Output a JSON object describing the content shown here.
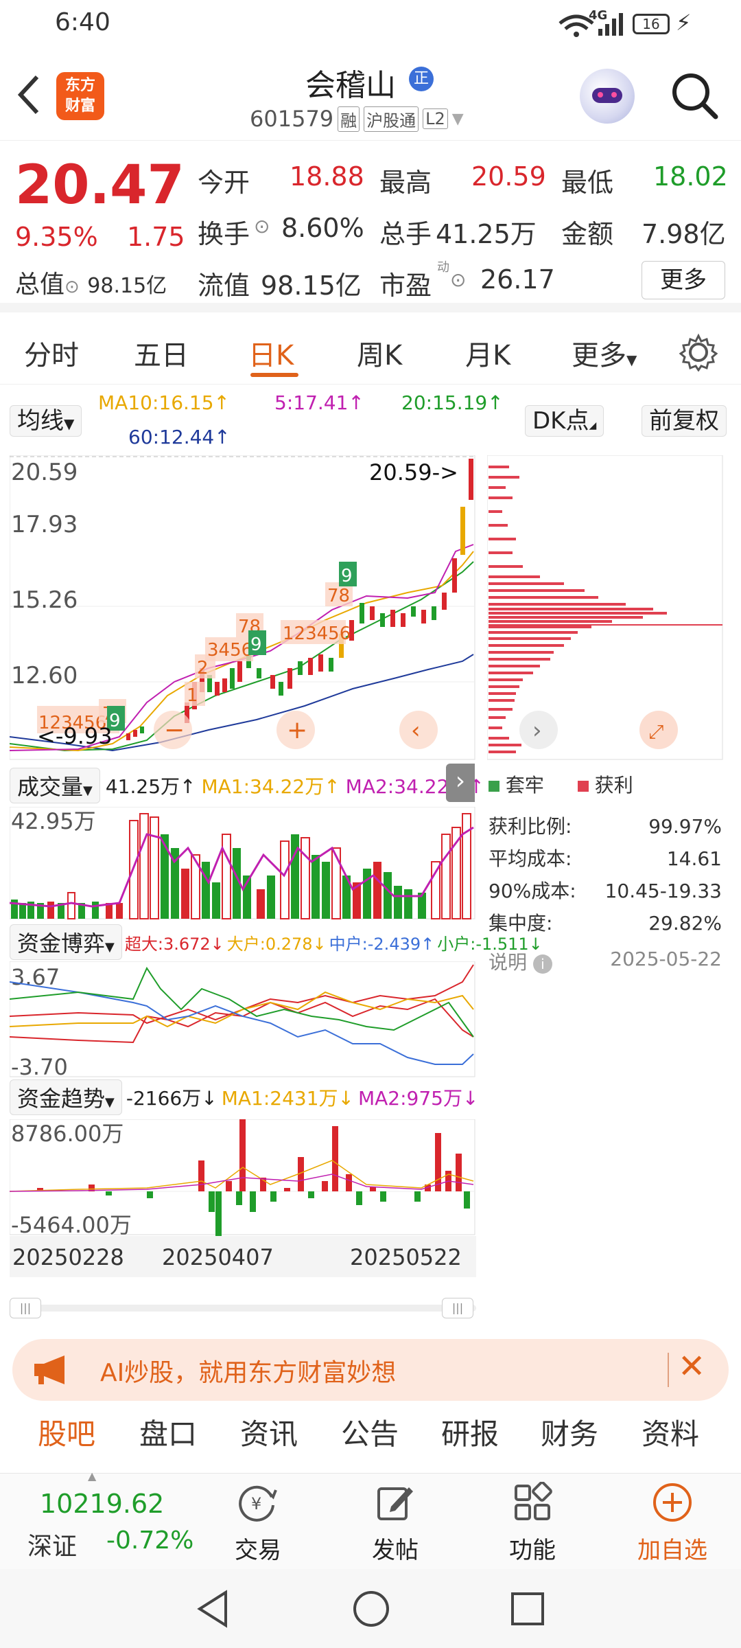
{
  "status": {
    "time": "6:40",
    "network": "4G",
    "battery": "16"
  },
  "header": {
    "brand_line1": "东方",
    "brand_line2": "财富",
    "stock_name": "会稽山",
    "name_badge": "正",
    "code": "601579",
    "badge_margin": "融",
    "badge_connect": "沪股通",
    "badge_level": "L2"
  },
  "quote": {
    "price": "20.47",
    "change_pct": "9.35%",
    "change_amt": "1.75",
    "open_label": "今开",
    "open": "18.88",
    "high_label": "最高",
    "high": "20.59",
    "low_label": "最低",
    "low": "18.02",
    "turnover_label": "换手",
    "turnover": "8.60%",
    "volume_label": "总手",
    "volume": "41.25万",
    "amount_label": "金额",
    "amount": "7.98亿",
    "mktcap_label": "总值",
    "mktcap": "98.15亿",
    "float_label": "流值",
    "float": "98.15亿",
    "pe_label": "市盈",
    "pe_sup": "动",
    "pe": "26.17",
    "more": "更多"
  },
  "tabs": [
    "分时",
    "五日",
    "日K",
    "周K",
    "月K",
    "更多"
  ],
  "active_tab": 2,
  "chart_controls": {
    "ma_btn": "均线",
    "ma10": "MA10:16.15↑",
    "ma5": "5:17.41↑",
    "ma20": "20:15.19↑",
    "ma60": "60:12.44↑",
    "dk_btn": "DK点",
    "adjust_btn": "前复权"
  },
  "colors": {
    "up": "#d9262c",
    "down": "#1f9d2a",
    "accent": "#e0621a",
    "ma5": "#c020b0",
    "ma10": "#e8a800",
    "ma20": "#1f9d2a",
    "ma60": "#1f3a9a"
  },
  "kline": {
    "yticks": [
      "20.59",
      "17.93",
      "15.26",
      "12.60"
    ],
    "high_marker": "20.59->",
    "low_marker": "<-9.93"
  },
  "volume_panel": {
    "btn": "成交量",
    "val": "41.25万↑",
    "ma1": "MA1:34.22万↑",
    "ma2": "MA2:34.22万↑",
    "ytick": "42.95万"
  },
  "capital_game": {
    "btn": "资金博弈",
    "super": "超大:3.672↓",
    "big": "大户:0.278↓",
    "mid": "中户:-2.439↑",
    "small": "小户:-1.511↓",
    "ymax": "3.67",
    "ymin": "-3.70"
  },
  "capital_trend": {
    "btn": "资金趋势",
    "val": "-2166万↓",
    "ma1": "MA1:2431万↓",
    "ma2": "MA2:975万↓",
    "ymax": "8786.00万",
    "ymin": "-5464.00万"
  },
  "dates": [
    "20250228",
    "20250407",
    "20250522"
  ],
  "chip_dist": {
    "legend_trapped": "套牢",
    "legend_profit": "获利",
    "rows": [
      {
        "label": "获利比例:",
        "value": "99.97%"
      },
      {
        "label": "平均成本:",
        "value": "14.61"
      },
      {
        "label": "90%成本:",
        "value": "10.45-19.33"
      },
      {
        "label": "集中度:",
        "value": "29.82%"
      }
    ],
    "note": "说明",
    "date": "2025-05-22"
  },
  "ai_banner": {
    "text": "AI炒股，就用东方财富妙想"
  },
  "bottom_tabs": [
    "股吧",
    "盘口",
    "资讯",
    "公告",
    "研报",
    "财务",
    "资料"
  ],
  "toolbar": {
    "index_value": "10219.62",
    "index_name": "深证",
    "index_change": "-0.72%",
    "trade": "交易",
    "post": "发帖",
    "func": "功能",
    "add": "加自选"
  }
}
